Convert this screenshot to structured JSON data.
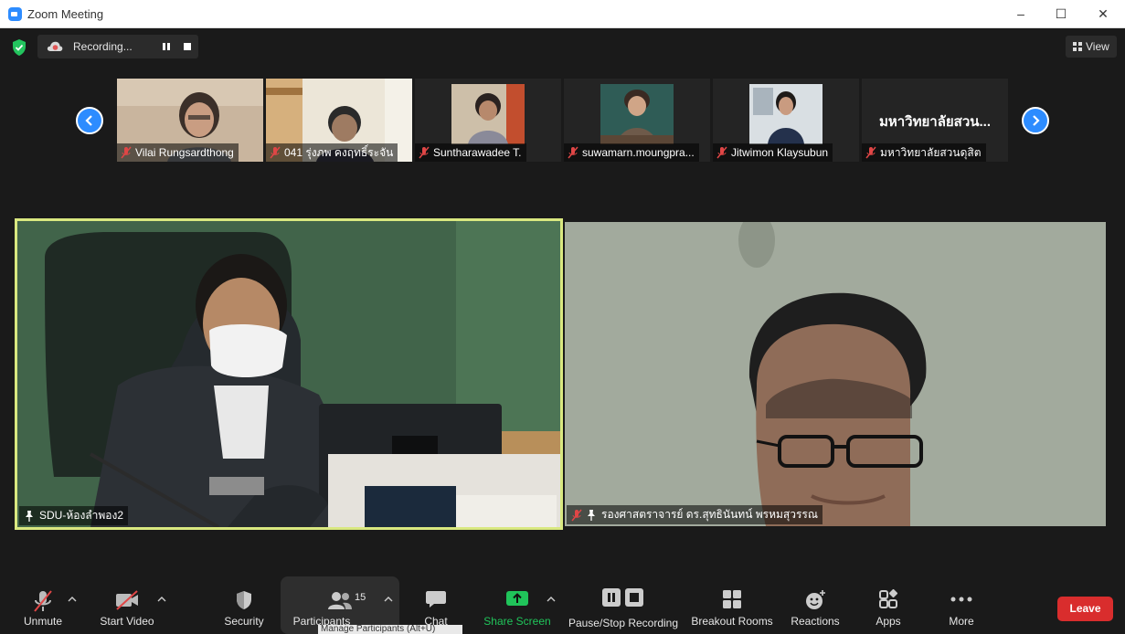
{
  "window": {
    "title": "Zoom Meeting",
    "controls": {
      "minimize": "–",
      "maximize": "☐",
      "close": "✕"
    }
  },
  "recording": {
    "label": "Recording...",
    "color": "#e05555"
  },
  "view_button": {
    "label": "View"
  },
  "thumbnails": [
    {
      "name": "Vilai Rungsardthong",
      "muted": true
    },
    {
      "name": "041 รุ่งภพ คงฤทธิ์ระจัน",
      "muted": true
    },
    {
      "name": "Suntharawadee T.",
      "muted": true
    },
    {
      "name": "suwamarn.moungpra...",
      "muted": true
    },
    {
      "name": "Jitwimon Klaysubun",
      "muted": true
    },
    {
      "name": "มหาวิทยาลัยสวนดุสิต",
      "muted": true,
      "display_text": "มหาวิทยาลัยสวน..."
    }
  ],
  "main_videos": {
    "left": {
      "name": "SDU-ห้องลำพอง2",
      "active_speaker": true,
      "highlight_color": "#d9e880"
    },
    "right": {
      "name": "รองศาสตราจารย์ ดร.สุทธินันทน์ พรหมสุวรรณ",
      "muted": true
    }
  },
  "toolbar": {
    "unmute": "Unmute",
    "start_video": "Start Video",
    "security": "Security",
    "participants": "Participants",
    "participants_count": "15",
    "chat": "Chat",
    "share_screen": "Share Screen",
    "pause_stop_recording": "Pause/Stop Recording",
    "breakout_rooms": "Breakout Rooms",
    "reactions": "Reactions",
    "apps": "Apps",
    "more": "More",
    "leave": "Leave"
  },
  "tooltip": "Manage Participants (Alt+U)",
  "colors": {
    "accent": "#2d8cff",
    "share_green": "#20c45a",
    "leave_red": "#d92d2d",
    "muted_red": "#e04646"
  }
}
